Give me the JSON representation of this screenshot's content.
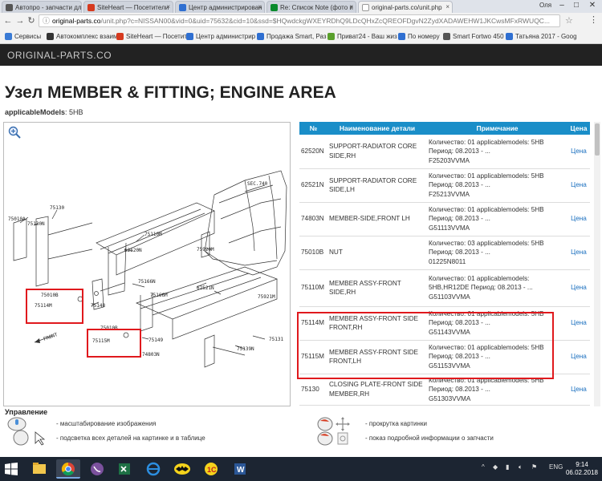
{
  "browser": {
    "tabs": [
      {
        "label": "Автопро - запчасти для",
        "color": "#555"
      },
      {
        "label": "SiteHeart — Посетители",
        "color": "#d63a1f"
      },
      {
        "label": "Центр администрирован",
        "color": "#2f6fd1"
      },
      {
        "label": "Re: Список Note (фото и",
        "color": "#0a8a2c"
      },
      {
        "label": "original-parts.co/unit.php",
        "color": "#777"
      }
    ],
    "user": "Оля",
    "url_host": "original-parts.co",
    "url_path": "/unit.php?c=NISSAN00&vid=0&uid=75632&cid=10&ssd=$HQwdckgWXEYRDhQ9LDcQHxZcQREOFDgvN2ZydXADAWEHW1JKCwsMFxRWUQC...",
    "bookmarks": [
      {
        "label": "Сервисы",
        "color": "#3a7bd5"
      },
      {
        "label": "Автокомплекс взаим",
        "color": "#333"
      },
      {
        "label": "SiteHeart — Посетит",
        "color": "#d63a1f"
      },
      {
        "label": "Центр администрир",
        "color": "#2f6fd1"
      },
      {
        "label": "Продажа Smart, Раз",
        "color": "#2f6fd1"
      },
      {
        "label": "Приват24 - Ваш жиз",
        "color": "#5aa02c"
      },
      {
        "label": "По номеру",
        "color": "#2f6fd1"
      },
      {
        "label": "Smart Fortwo 450",
        "color": "#555"
      },
      {
        "label": "Татьяна 2017 - Goog",
        "color": "#2f6fd1"
      }
    ]
  },
  "site": {
    "logo": "ORIGINAL-PARTS.CO"
  },
  "page": {
    "title": "Узел MEMBER & FITTING; ENGINE AREA",
    "models_label": "applicableModels",
    "models_value": "5HB"
  },
  "diagram": {
    "labels": [
      "SEC.740",
      "75130",
      "75010A",
      "75130N",
      "75110M",
      "62520N",
      "75920M",
      "75166N",
      "62521N",
      "75166M",
      "75010B",
      "75114M",
      "75148",
      "75010B",
      "75115M",
      "75149",
      "74803N",
      "75139N",
      "75131",
      "75921M"
    ]
  },
  "table": {
    "headers": {
      "num": "№",
      "name": "Наименование детали",
      "note": "Примечание",
      "price": "Цена"
    },
    "rows": [
      {
        "num": "62520N",
        "name": "SUPPORT-RADIATOR CORE SIDE,RH",
        "note": [
          "Количество: 01 applicablemodels: 5HB",
          "Период: 08.2013 - ...",
          "F25203VVMA"
        ],
        "price": "Цена"
      },
      {
        "num": "62521N",
        "name": "SUPPORT-RADIATOR CORE SIDE,LH",
        "note": [
          "Количество: 01 applicablemodels: 5HB",
          "Период: 08.2013 - ...",
          "F25213VVMA"
        ],
        "price": "Цена"
      },
      {
        "num": "74803N",
        "name": "MEMBER-SIDE,FRONT LH",
        "note": [
          "Количество: 01 applicablemodels: 5HB",
          "Период: 08.2013 - ...",
          "G51113VVMA"
        ],
        "price": "Цена"
      },
      {
        "num": "75010B",
        "name": "NUT",
        "note": [
          "Количество: 03 applicablemodels: 5HB",
          "Период: 08.2013 - ...",
          "01225N8011"
        ],
        "price": "Цена"
      },
      {
        "num": "75110M",
        "name": "MEMBER ASSY-FRONT SIDE,RH",
        "note": [
          "Количество: 01 applicablemodels:",
          "5HB,HR12DE Период: 08.2013 - ...",
          "G51103VVMA"
        ],
        "price": "Цена"
      },
      {
        "num": "75114M",
        "name": "MEMBER ASSY-FRONT SIDE FRONT,RH",
        "note": [
          "Количество: 01 applicablemodels: 5HB",
          "Период: 08.2013 - ...",
          "G51143VVMA"
        ],
        "price": "Цена"
      },
      {
        "num": "75115M",
        "name": "MEMBER ASSY-FRONT SIDE FRONT,LH",
        "note": [
          "Количество: 01 applicablemodels: 5HB",
          "Период: 08.2013 - ...",
          "G51153VVMA"
        ],
        "price": "Цена"
      },
      {
        "num": "75130",
        "name": "CLOSING PLATE-FRONT SIDE MEMBER,RH",
        "note": [
          "Количество: 01 applicablemodels: 5HB",
          "Период: 08.2013 - ...",
          "G51303VVMA"
        ],
        "price": "Цена"
      }
    ]
  },
  "controls": {
    "title": "Управление",
    "zoom": "- масштабирование изображения",
    "highlight": "- подсветка всех деталей на картинке и в таблице",
    "scroll": "- прокрутка картинки",
    "info": "- показ подробной информации о запчасти"
  },
  "taskbar": {
    "lang": "ENG",
    "time": "9:14",
    "date": "06.02.2018"
  }
}
